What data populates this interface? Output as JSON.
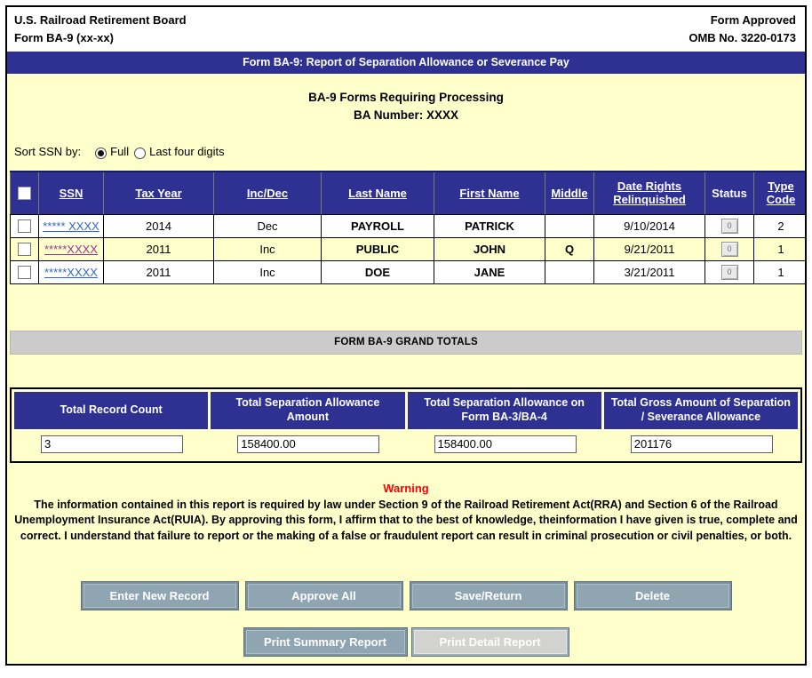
{
  "header": {
    "left_line1": "U.S. Railroad Retirement Board",
    "left_line2": "Form BA-9 (xx-xx)",
    "right_line1": "Form Approved",
    "right_line2": "OMB No. 3220-0173"
  },
  "banner": "Form BA-9: Report of Separation Allowance or Severance Pay",
  "title": {
    "line1": "BA-9 Forms Requiring Processing",
    "line2_label": "BA Number:",
    "line2_value": "XXXX"
  },
  "sort": {
    "label": "Sort SSN by:",
    "options": [
      {
        "label": "Full",
        "selected": true
      },
      {
        "label": "Last four digits",
        "selected": false
      }
    ]
  },
  "table": {
    "headers": [
      "SSN",
      "Tax Year",
      "Inc/Dec",
      "Last Name",
      "First Name",
      "Middle",
      "Date Rights Relinquished",
      "Status",
      "Type Code"
    ],
    "status_button_label": "0",
    "rows": [
      {
        "ssn": "***** XXXX",
        "tax_year": "2014",
        "inc_dec": "Dec",
        "last_name": "PAYROLL",
        "first_name": "PATRICK",
        "middle": "",
        "date_rights": "9/10/2014",
        "type_code": "2"
      },
      {
        "ssn": "*****XXXX",
        "tax_year": "2011",
        "inc_dec": "Inc",
        "last_name": "PUBLIC",
        "first_name": "JOHN",
        "middle": "Q",
        "date_rights": "9/21/2011",
        "type_code": "1"
      },
      {
        "ssn": "*****XXXX",
        "tax_year": "2011",
        "inc_dec": "Inc",
        "last_name": "DOE",
        "first_name": "JANE",
        "middle": "",
        "date_rights": "3/21/2011",
        "type_code": "1"
      }
    ]
  },
  "grand_totals": {
    "bar_label": "FORM BA-9 GRAND TOTALS",
    "columns": [
      {
        "header": "Total Record Count",
        "value": "3"
      },
      {
        "header": "Total Separation Allowance Amount",
        "value": "158400.00"
      },
      {
        "header": "Total Separation Allowance on Form BA-3/BA-4",
        "value": "158400.00"
      },
      {
        "header": "Total Gross Amount of Separation / Severance Allowance",
        "value": "201176"
      }
    ]
  },
  "warning": {
    "title": "Warning",
    "body": "The information contained in this report is required by law under Section 9 of the Railroad Retirement Act(RRA) and Section 6 of the Railroad Unemployment Insurance Act(RUIA). By approving this form, I affirm that to the best of knowledge, theinformation I have given is true, complete and correct. I understand that failure to report or the making of a false or fraudulent report can result in criminal prosecution or civil penalties, or both."
  },
  "buttons": {
    "row1": [
      "Enter New Record",
      "Approve All",
      "Save/Return",
      "Delete"
    ],
    "row2": [
      {
        "label": "Print Summary Report",
        "disabled": false
      },
      {
        "label": "Print Detail Report",
        "disabled": true
      }
    ]
  },
  "colors": {
    "navy_accent": "#2E3192",
    "page_background": "#FFFFCC",
    "highlight_row": "#FFFFCC",
    "link_blue": "#3366CC",
    "link_visited_purple": "#993399",
    "gray_bar": "#CBCBCB",
    "button_slate": "#8FA5B1",
    "button_disabled": "#D2D2CE",
    "warning_red": "#FF0000"
  }
}
